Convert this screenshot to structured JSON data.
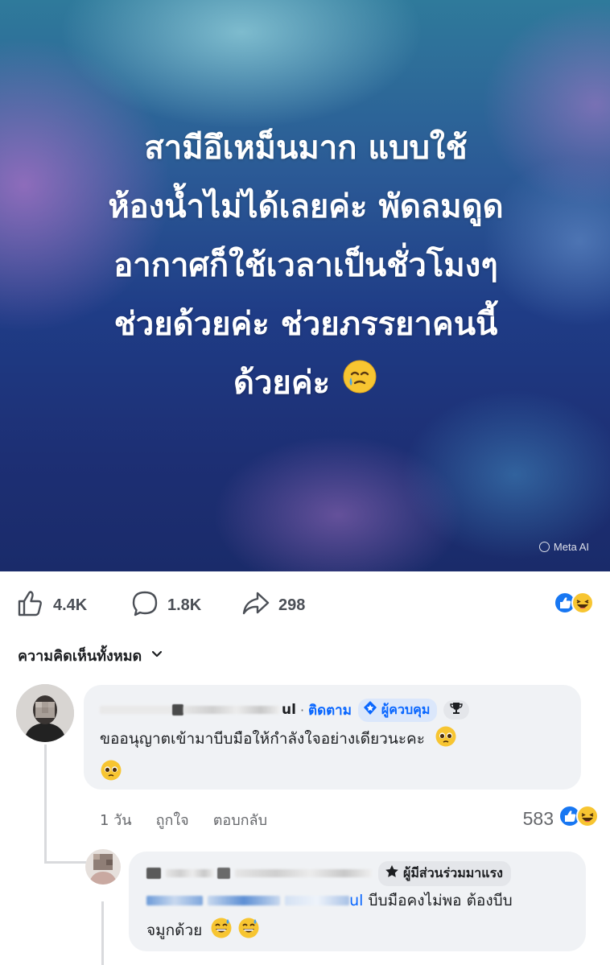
{
  "post": {
    "text_lines": [
      "สามีอึเหม็นมาก แบบใช้",
      "ห้องน้ำไม่ได้เลยค่ะ พัดลมดูด",
      "อากาศก็ใช้เวลาเป็นชั่วโมงๆ",
      "ช่วยด้วยค่ะ ช่วยภรรยาคนนี้",
      "ด้วยค่ะ"
    ],
    "watermark": "Meta AI",
    "emoji_icon": "face-holding-back-tears-icon"
  },
  "actions": {
    "likes": "4.4K",
    "comments": "1.8K",
    "shares": "298"
  },
  "comments_header": {
    "label": "ความคิดเห็นทั้งหมด",
    "icon": "chevron-down-icon"
  },
  "comments": [
    {
      "author_visible": "ul",
      "follow_label": "ติดตาม",
      "badge_label": "ผู้ควบคุม",
      "text": "ขออนุญาตเข้ามาบีบมือให้กำลังใจอย่างเดียวนะคะ",
      "time": "1 วัน",
      "like_label": "ถูกใจ",
      "reply_label": "ตอบกลับ",
      "reaction_count": "583"
    },
    {
      "badge_label": "ผู้มีส่วนร่วมมาแรง",
      "mention_visible": "ul",
      "text_line1": "บีบมือคงไม่พอ ต้องบีบ",
      "text_line2": "จมูกด้วย"
    }
  ],
  "colors": {
    "link_blue": "#0866ff",
    "bubble_bg": "#f0f2f5",
    "muted_text": "#65676b"
  }
}
